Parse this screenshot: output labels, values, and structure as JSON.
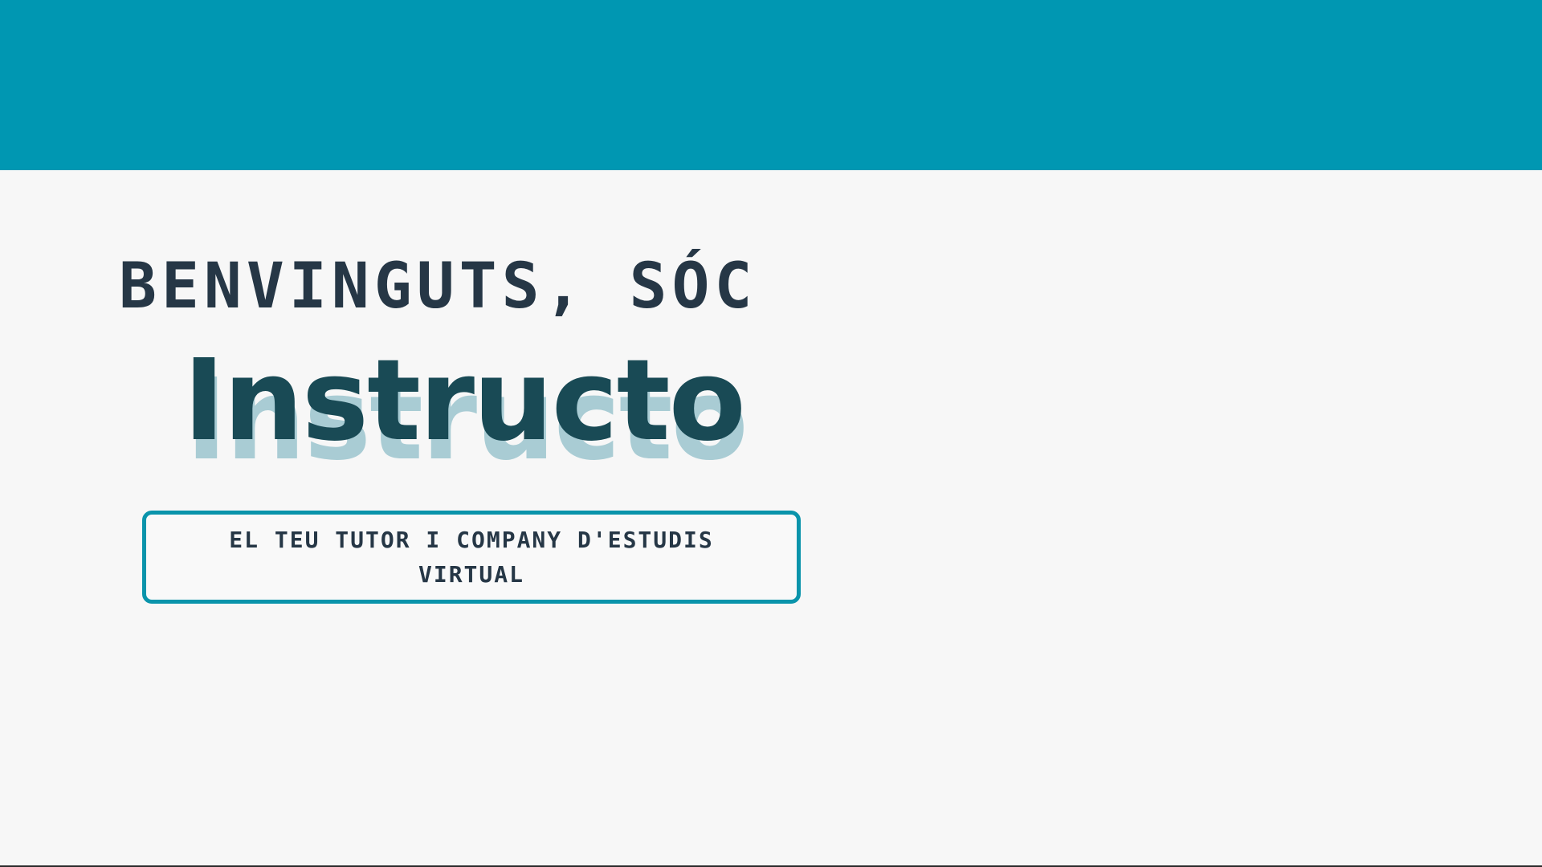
{
  "colors": {
    "banner": "#0097b2",
    "background": "#f7f7f7",
    "heading_text": "#263746",
    "brand": "#194a55",
    "brand_shadow": "#a9ccd4",
    "tagline_border": "#0a94ab"
  },
  "hero": {
    "welcome": "BENVINGUTS, SÓC",
    "brand": "Instructo",
    "tagline": "EL TEU TUTOR I COMPANY D'ESTUDIS VIRTUAL"
  }
}
